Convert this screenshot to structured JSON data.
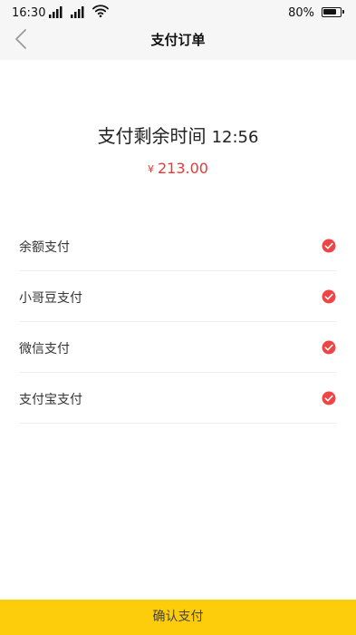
{
  "status_bar": {
    "time": "16:30",
    "battery_percent": "80%",
    "battery_level": 0.8
  },
  "header": {
    "title": "支付订单"
  },
  "countdown": {
    "label": "支付剩余时间",
    "time": "12:56"
  },
  "amount": {
    "currency": "¥",
    "value": "213.00",
    "color": "#e53935"
  },
  "payment_methods": [
    {
      "label": "余额支付",
      "icon": "check-circle-icon",
      "selected": true
    },
    {
      "label": "小哥豆支付",
      "icon": "check-circle-icon",
      "selected": true
    },
    {
      "label": "微信支付",
      "icon": "check-circle-icon",
      "selected": true
    },
    {
      "label": "支付宝支付",
      "icon": "check-circle-icon",
      "selected": true
    }
  ],
  "confirm": {
    "label": "确认支付",
    "color": "#fdcd0c"
  }
}
